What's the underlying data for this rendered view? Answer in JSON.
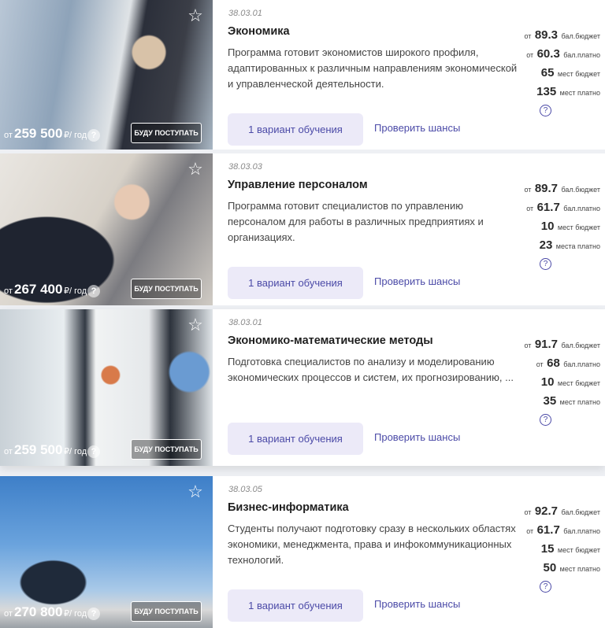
{
  "programs": [
    {
      "code": "38.03.01",
      "title": "Экономика",
      "description": "Программа готовит экономистов широкого профиля, адаптированных к различным направлениям экономической и управленческой деятельности.",
      "price_prefix": "от",
      "price": "259 500",
      "price_unit": "₽/ год",
      "apply_label": "БУДУ ПОСТУПАТЬ",
      "variant_label": "1 вариант обучения",
      "chance_label": "Проверить шансы",
      "stats": [
        {
          "pre": "от",
          "num": "89.3",
          "lbl": "бал.бюджет"
        },
        {
          "pre": "от",
          "num": "60.3",
          "lbl": "бал.платно"
        },
        {
          "pre": "",
          "num": "65",
          "lbl": "мест бюджет"
        },
        {
          "pre": "",
          "num": "135",
          "lbl": "мест платно"
        }
      ]
    },
    {
      "code": "38.03.03",
      "title": "Управление персоналом",
      "description": "Программа готовит специалистов по управлению персоналом для работы в различных предприятиях и организациях.",
      "price_prefix": "от",
      "price": "267 400",
      "price_unit": "₽/ год",
      "apply_label": "БУДУ ПОСТУПАТЬ",
      "variant_label": "1 вариант обучения",
      "chance_label": "Проверить шансы",
      "stats": [
        {
          "pre": "от",
          "num": "89.7",
          "lbl": "бал.бюджет"
        },
        {
          "pre": "от",
          "num": "61.7",
          "lbl": "бал.платно"
        },
        {
          "pre": "",
          "num": "10",
          "lbl": "мест бюджет"
        },
        {
          "pre": "",
          "num": "23",
          "lbl": "места платно"
        }
      ]
    },
    {
      "code": "38.03.01",
      "title": "Экономико-математические методы",
      "description": "Подготовка специалистов по анализу и моделированию экономических процессов и систем, их прогнозированию, ...",
      "price_prefix": "от",
      "price": "259 500",
      "price_unit": "₽/ год",
      "apply_label": "БУДУ ПОСТУПАТЬ",
      "variant_label": "1 вариант обучения",
      "chance_label": "Проверить шансы",
      "stats": [
        {
          "pre": "от",
          "num": "91.7",
          "lbl": "бал.бюджет"
        },
        {
          "pre": "от",
          "num": "68",
          "lbl": "бал.платно"
        },
        {
          "pre": "",
          "num": "10",
          "lbl": "мест бюджет"
        },
        {
          "pre": "",
          "num": "35",
          "lbl": "мест платно"
        }
      ]
    },
    {
      "code": "38.03.05",
      "title": "Бизнес-информатика",
      "description": "Студенты получают подготовку сразу в нескольких областях экономики, менеджмента, права и инфокоммуникационных технологий.",
      "price_prefix": "от",
      "price": "270 800",
      "price_unit": "₽/ год",
      "apply_label": "БУДУ ПОСТУПАТЬ",
      "variant_label": "1 вариант обучения",
      "chance_label": "Проверить шансы",
      "stats": [
        {
          "pre": "от",
          "num": "92.7",
          "lbl": "бал.бюджет"
        },
        {
          "pre": "от",
          "num": "61.7",
          "lbl": "бал.платно"
        },
        {
          "pre": "",
          "num": "15",
          "lbl": "мест бюджет"
        },
        {
          "pre": "",
          "num": "50",
          "lbl": "мест платно"
        }
      ]
    }
  ],
  "icons": {
    "favorite": "star-outline-icon",
    "help": "question-icon",
    "help_glyph": "?"
  }
}
